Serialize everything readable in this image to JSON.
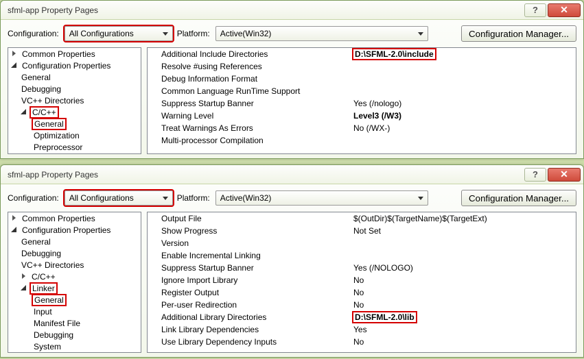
{
  "win1": {
    "title": "sfml-app Property Pages",
    "config_label": "Configuration:",
    "config_value": "All Configurations",
    "platform_label": "Platform:",
    "platform_value": "Active(Win32)",
    "cfg_mgr": "Configuration Manager...",
    "tree": {
      "common": "Common Properties",
      "configprops": "Configuration Properties",
      "general": "General",
      "debugging": "Debugging",
      "vcdirs": "VC++ Directories",
      "ccpp": "C/C++",
      "ccpp_general": "General",
      "optimization": "Optimization",
      "preprocessor": "Preprocessor"
    },
    "props": [
      {
        "name": "Additional Include Directories",
        "val": "D:\\SFML-2.0\\include",
        "bold": true,
        "red": true
      },
      {
        "name": "Resolve #using References",
        "val": ""
      },
      {
        "name": "Debug Information Format",
        "val": ""
      },
      {
        "name": "Common Language RunTime Support",
        "val": ""
      },
      {
        "name": "Suppress Startup Banner",
        "val": "Yes (/nologo)"
      },
      {
        "name": "Warning Level",
        "val": "Level3 (/W3)",
        "bold": true
      },
      {
        "name": "Treat Warnings As Errors",
        "val": "No (/WX-)"
      },
      {
        "name": "Multi-processor Compilation",
        "val": ""
      }
    ]
  },
  "win2": {
    "title": "sfml-app Property Pages",
    "config_label": "Configuration:",
    "config_value": "All Configurations",
    "platform_label": "Platform:",
    "platform_value": "Active(Win32)",
    "cfg_mgr": "Configuration Manager...",
    "tree": {
      "common": "Common Properties",
      "configprops": "Configuration Properties",
      "general": "General",
      "debugging": "Debugging",
      "vcdirs": "VC++ Directories",
      "ccpp": "C/C++",
      "linker": "Linker",
      "linker_general": "General",
      "input": "Input",
      "manifest": "Manifest File",
      "linker_debugging": "Debugging",
      "system": "System"
    },
    "props": [
      {
        "name": "Output File",
        "val": "$(OutDir)$(TargetName)$(TargetExt)"
      },
      {
        "name": "Show Progress",
        "val": "Not Set"
      },
      {
        "name": "Version",
        "val": ""
      },
      {
        "name": "Enable Incremental Linking",
        "val": ""
      },
      {
        "name": "Suppress Startup Banner",
        "val": "Yes (/NOLOGO)"
      },
      {
        "name": "Ignore Import Library",
        "val": "No"
      },
      {
        "name": "Register Output",
        "val": "No"
      },
      {
        "name": "Per-user Redirection",
        "val": "No"
      },
      {
        "name": "Additional Library Directories",
        "val": "D:\\SFML-2.0\\lib",
        "bold": true,
        "red": true
      },
      {
        "name": "Link Library Dependencies",
        "val": "Yes"
      },
      {
        "name": "Use Library Dependency Inputs",
        "val": "No"
      }
    ]
  }
}
